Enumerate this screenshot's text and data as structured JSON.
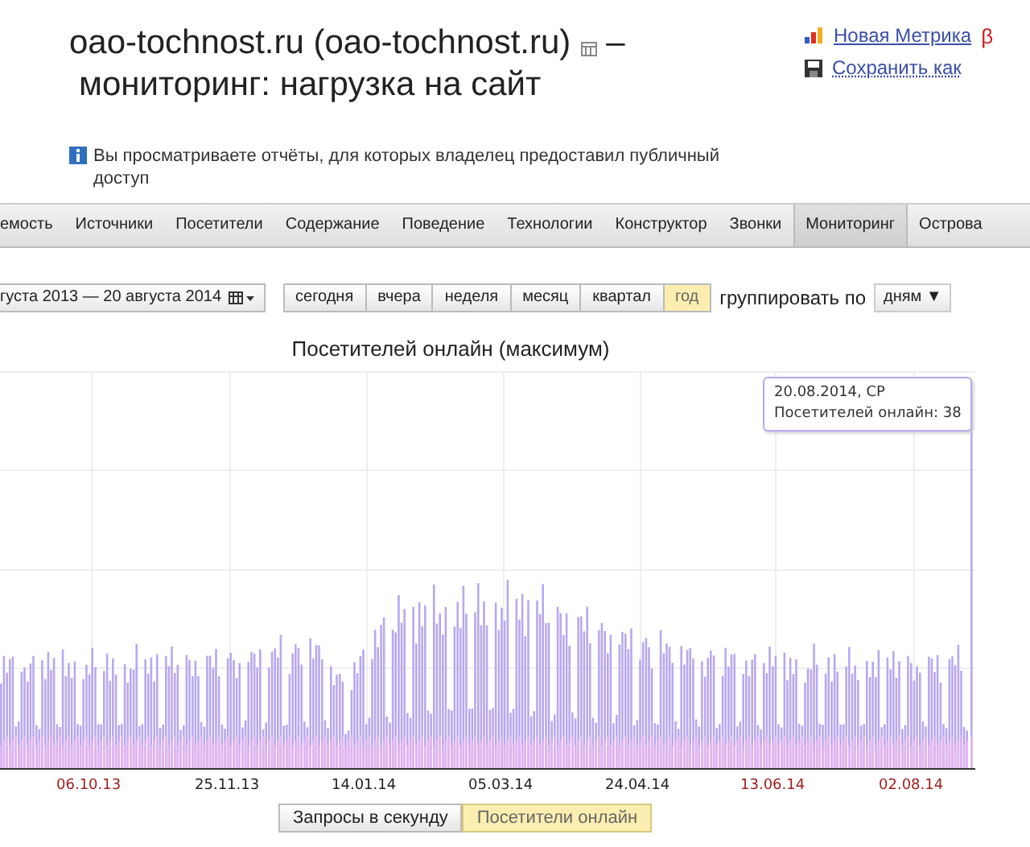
{
  "header": {
    "title_line1": "oao-tochnost.ru (oao-tochnost.ru)",
    "dash": "–",
    "title_line2": "мониторинг: нагрузка на сайт",
    "links": [
      {
        "kind": "metrika",
        "label": "Новая Метрика",
        "badge": "β"
      },
      {
        "kind": "save",
        "label": "Сохранить как"
      }
    ]
  },
  "notice": "Вы просматриваете отчёты, для которых владелец предоставил публичный доступ",
  "tabs": [
    {
      "label": "емость",
      "selected": false
    },
    {
      "label": "Источники",
      "selected": false
    },
    {
      "label": "Посетители",
      "selected": false
    },
    {
      "label": "Содержание",
      "selected": false
    },
    {
      "label": "Поведение",
      "selected": false
    },
    {
      "label": "Технологии",
      "selected": false
    },
    {
      "label": "Конструктор",
      "selected": false
    },
    {
      "label": "Звонки",
      "selected": false
    },
    {
      "label": "Мониторинг",
      "selected": true
    },
    {
      "label": "Острова",
      "selected": false
    }
  ],
  "date_range": "густа 2013 — 20 августа 2014",
  "periods": [
    {
      "label": "сегодня",
      "selected": false
    },
    {
      "label": "вчера",
      "selected": false
    },
    {
      "label": "неделя",
      "selected": false
    },
    {
      "label": "месяц",
      "selected": false
    },
    {
      "label": "квартал",
      "selected": false
    },
    {
      "label": "год",
      "selected": true
    }
  ],
  "group_label": "группировать по",
  "group_value": "дням",
  "group_caret": "▼",
  "chart": {
    "title": "Посетителей онлайн (максимум)",
    "tooltip": {
      "date": "20.08.2014, СР",
      "text": "Посетителей онлайн: 38"
    },
    "x_labels": [
      {
        "label": "06.10.13",
        "color": "#a02020"
      },
      {
        "label": "25.11.13",
        "color": "#222222"
      },
      {
        "label": "14.01.14",
        "color": "#222222"
      },
      {
        "label": "05.03.14",
        "color": "#222222"
      },
      {
        "label": "24.04.14",
        "color": "#222222"
      },
      {
        "label": "13.06.14",
        "color": "#a02020"
      },
      {
        "label": "02.08.14",
        "color": "#a02020"
      }
    ]
  },
  "metrics": [
    {
      "label": "Запросы в секунду",
      "selected": false
    },
    {
      "label": "Посетители онлайн",
      "selected": true
    }
  ]
}
